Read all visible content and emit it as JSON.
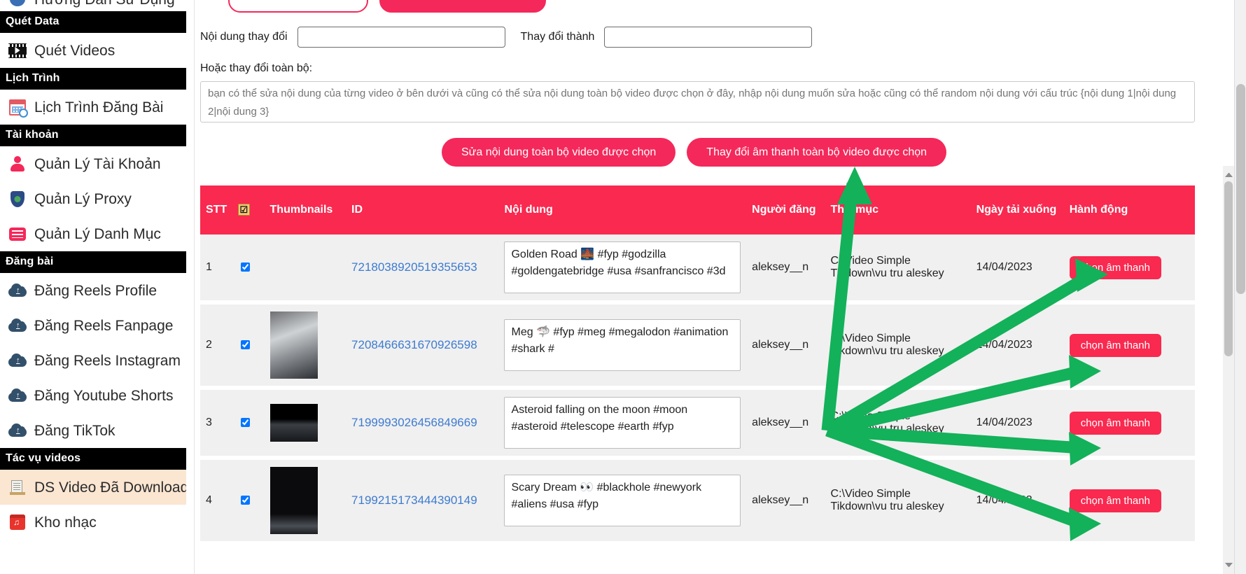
{
  "sidebar": {
    "partial_top_item": {
      "label": "Hướng Dẫn Sử Dụng",
      "icon": "book-icon"
    },
    "groups": [
      {
        "title": "Quét Data",
        "items": [
          {
            "label": "Quét Videos",
            "icon": "film-icon"
          }
        ]
      },
      {
        "title": "Lịch Trình",
        "items": [
          {
            "label": "Lịch Trình Đăng Bài",
            "icon": "calendar-icon"
          }
        ]
      },
      {
        "title": "Tài khoản",
        "items": [
          {
            "label": "Quản Lý Tài Khoản",
            "icon": "person-icon"
          },
          {
            "label": "Quản Lý Proxy",
            "icon": "shield-icon"
          },
          {
            "label": "Quản Lý Danh Mục",
            "icon": "list-icon"
          }
        ]
      },
      {
        "title": "Đăng bài",
        "items": [
          {
            "label": "Đăng Reels Profile",
            "icon": "cloud-upload-icon"
          },
          {
            "label": "Đăng Reels Fanpage",
            "icon": "cloud-upload-icon"
          },
          {
            "label": "Đăng Reels Instagram",
            "icon": "cloud-upload-icon"
          },
          {
            "label": "Đăng Youtube Shorts",
            "icon": "cloud-upload-icon"
          },
          {
            "label": "Đăng TikTok",
            "icon": "cloud-upload-icon"
          }
        ]
      },
      {
        "title": "Tác vụ videos",
        "items": [
          {
            "label": "DS Video Đã Download",
            "icon": "document-icon",
            "active": true
          },
          {
            "label": "Kho nhạc",
            "icon": "music-icon"
          }
        ]
      }
    ]
  },
  "toolbar": {
    "top_buttons": [
      {
        "label": "",
        "style": "outline"
      },
      {
        "label": "",
        "style": "solid"
      }
    ]
  },
  "find_replace": {
    "find_label": "Nội dung thay đổi",
    "find_value": "",
    "replace_label": "Thay đổi thành",
    "replace_value": ""
  },
  "bulk": {
    "section_label": "Hoặc thay đổi toàn bộ:",
    "textarea_placeholder": "bạn có thể sửa nội dung của từng video ở bên dưới và cũng có thể sửa nội dung toàn bộ video được chọn ở đây, nhập nội dung muốn sửa hoặc cũng có thể random nội dung với cấu trúc {nội dung 1|nội dung 2|nội dung 3}",
    "textarea_value": "",
    "edit_all_button": "Sửa nội dung toàn bộ video được chọn",
    "change_sound_button": "Thay đổi âm thanh toàn bộ video được chọn"
  },
  "table": {
    "headers": {
      "stt": "STT",
      "select_all": "☑",
      "thumbnails": "Thumbnails",
      "id": "ID",
      "content": "Nội dung",
      "user": "Người đăng",
      "folder": "Thư mục",
      "date": "Ngày tải xuống",
      "action": "Hành động"
    },
    "select_all_checked": true,
    "action_button_label": "chọn âm thanh",
    "rows": [
      {
        "stt": "1",
        "checked": true,
        "thumb": "none",
        "id": "7218038920519355653",
        "content": "Golden Road 🌉 #fyp #godzilla #goldengatebridge #usa #sanfrancisco #3d",
        "user": "aleksey__n",
        "folder": "C:\\Video Simple Tikdown\\vu tru aleskey",
        "date": "14/04/2023",
        "action": "chọn âm thanh"
      },
      {
        "stt": "2",
        "checked": true,
        "thumb": "t1",
        "id": "7208466631670926598",
        "content": "Meg 🦈 #fyp #meg #megalodon #animation #shark #",
        "user": "aleksey__n",
        "folder": "C:\\Video Simple Tikdown\\vu tru aleskey",
        "date": "14/04/2023",
        "action": "chọn âm thanh"
      },
      {
        "stt": "3",
        "checked": true,
        "thumb": "t2",
        "id": "7199993026456849669",
        "content": "Asteroid falling on the moon #moon #asteroid #telescope #earth #fyp",
        "user": "aleksey__n",
        "folder": "C:\\Video Simple Tikdown\\vu tru aleskey",
        "date": "14/04/2023",
        "action": "chọn âm thanh"
      },
      {
        "stt": "4",
        "checked": true,
        "thumb": "t3",
        "id": "7199215173444390149",
        "content": "Scary Dream 👀 #blackhole #newyork #aliens #usa #fyp",
        "user": "aleksey__n",
        "folder": "C:\\Video Simple Tikdown\\vu tru aleskey",
        "date": "14/04/2023",
        "action": "chọn âm thanh"
      }
    ]
  },
  "colors": {
    "accent": "#f9294f",
    "accent_button": "#f4285a",
    "link": "#3d7bd0",
    "annotation": "#13b15a",
    "sidebar_section_bg": "#000000",
    "sidebar_active_bg": "#fbe6d2"
  }
}
